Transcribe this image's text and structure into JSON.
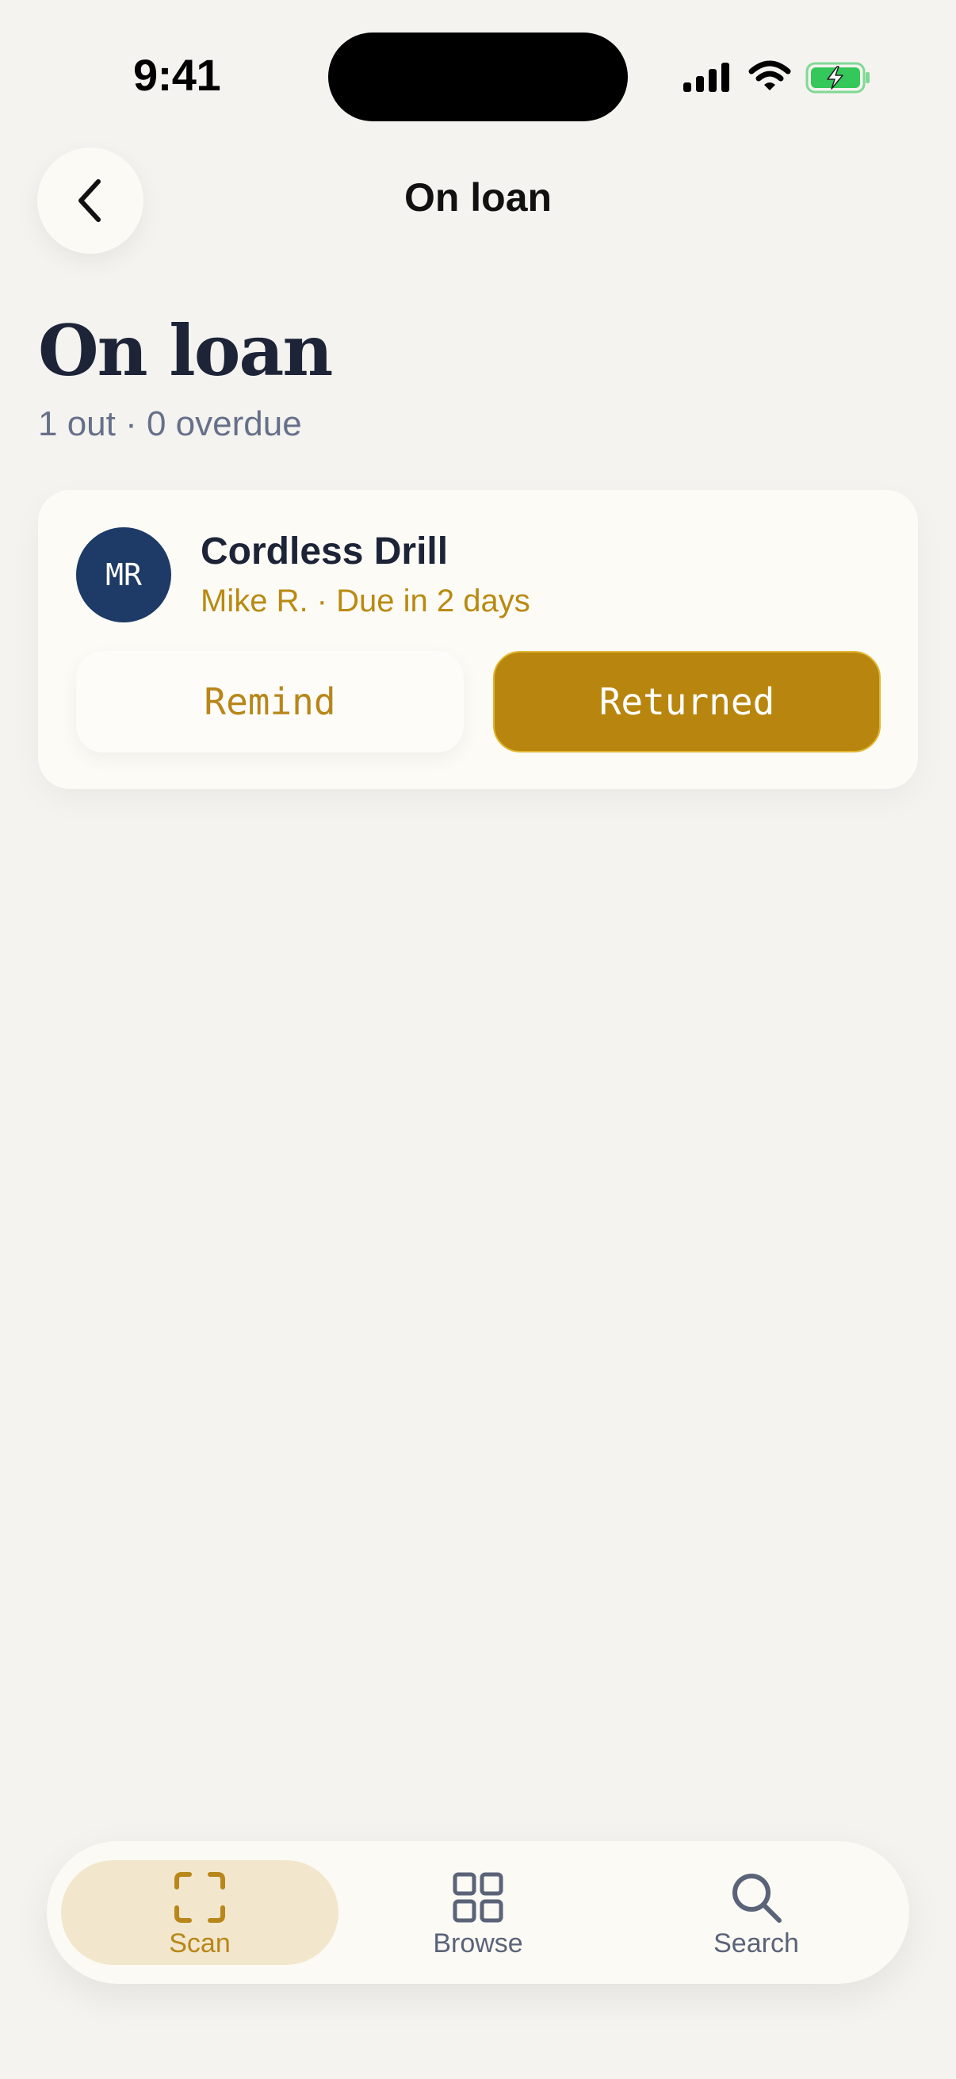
{
  "status_bar": {
    "time": "9:41"
  },
  "nav": {
    "title": "On loan",
    "back_icon": "chevron-left-icon"
  },
  "page": {
    "title": "On loan",
    "subtitle": "1 out · 0 overdue"
  },
  "loans": [
    {
      "avatar_initials": "MR",
      "item_name": "Cordless Drill",
      "meta": "Mike R. · Due in 2 days",
      "remind_label": "Remind",
      "returned_label": "Returned"
    }
  ],
  "tab_bar": {
    "tabs": [
      {
        "label": "Scan",
        "icon": "scan-frame-icon",
        "active": true
      },
      {
        "label": "Browse",
        "icon": "grid-icon",
        "active": false
      },
      {
        "label": "Search",
        "icon": "search-icon",
        "active": false
      }
    ]
  },
  "colors": {
    "accent": "#b8860e",
    "avatar_bg": "#1e3a66",
    "background": "#f4f3ef",
    "active_tab_bg": "#f2e7cc"
  }
}
